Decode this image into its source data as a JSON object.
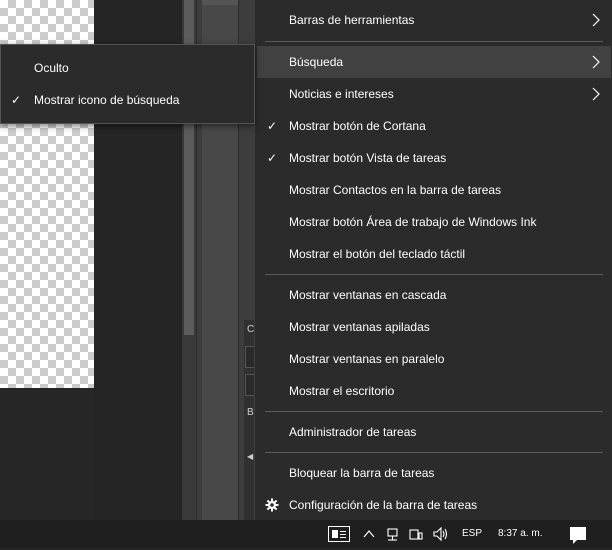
{
  "background": {
    "side_letters": [
      "C",
      "B"
    ]
  },
  "context_menu": {
    "items": [
      {
        "id": "toolbars",
        "label": "Barras de herramientas",
        "submenu": true
      },
      {
        "id": "search",
        "label": "Búsqueda",
        "submenu": true,
        "highlighted": true
      },
      {
        "id": "news",
        "label": "Noticias e intereses",
        "submenu": true
      },
      {
        "id": "cortana",
        "label": "Mostrar botón de Cortana",
        "checked": true
      },
      {
        "id": "task-view",
        "label": "Mostrar botón Vista de tareas",
        "checked": true
      },
      {
        "id": "contacts",
        "label": "Mostrar Contactos en la barra de tareas"
      },
      {
        "id": "ink",
        "label": "Mostrar botón Área de trabajo de Windows Ink"
      },
      {
        "id": "touch-keyboard",
        "label": "Mostrar el botón del teclado táctil"
      },
      {
        "id": "cascade",
        "label": "Mostrar ventanas en cascada"
      },
      {
        "id": "stacked",
        "label": "Mostrar ventanas apiladas"
      },
      {
        "id": "side-by-side",
        "label": "Mostrar ventanas en paralelo"
      },
      {
        "id": "desktop",
        "label": "Mostrar el escritorio"
      },
      {
        "id": "task-manager",
        "label": "Administrador de tareas"
      },
      {
        "id": "lock-taskbar",
        "label": "Bloquear la barra de tareas"
      },
      {
        "id": "taskbar-settings",
        "label": "Configuración de la barra de tareas",
        "icon": "gear-icon"
      }
    ],
    "check_glyph": "✓"
  },
  "search_submenu": {
    "items": [
      {
        "id": "hidden",
        "label": "Oculto",
        "checked": false
      },
      {
        "id": "show-search-icon",
        "label": "Mostrar icono de búsqueda",
        "checked": true
      }
    ]
  },
  "taskbar": {
    "language": "ESP",
    "time": "8:37 a. m.",
    "tray_icons": [
      "news-icon",
      "chevron-up-icon",
      "network-icon",
      "device-icon",
      "volume-icon",
      "notification-icon"
    ]
  },
  "colors": {
    "menu_bg": "#2b2b2b",
    "menu_highlight": "#414141",
    "separator": "#5a5a5a",
    "text": "#ffffff",
    "taskbar_bg": "#1f1f1f"
  }
}
